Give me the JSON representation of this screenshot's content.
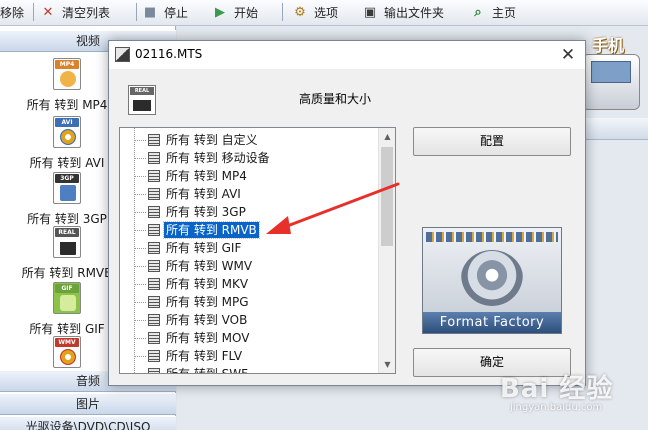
{
  "toolbar": {
    "items": [
      {
        "label": "移除",
        "icon": "remove-icon"
      },
      {
        "label": "清空列表",
        "icon": "clear-list-icon"
      },
      {
        "label": "停止",
        "icon": "stop-icon"
      },
      {
        "label": "开始",
        "icon": "start-icon"
      },
      {
        "label": "选项",
        "icon": "options-icon"
      },
      {
        "label": "输出文件夹",
        "icon": "output-folder-icon"
      },
      {
        "label": "主页",
        "icon": "home-icon"
      }
    ]
  },
  "sidebar": {
    "video_header": "视频",
    "items": [
      {
        "label": "所有 转到 MP4",
        "tag": "MP4",
        "icon": "mp4-format-icon",
        "color": "#d9822b"
      },
      {
        "label": "所有 转到 AVI",
        "tag": "AVI",
        "icon": "avi-format-icon",
        "color": "#3a6fb5"
      },
      {
        "label": "所有 转到 3GP",
        "tag": "3GP",
        "icon": "3gp-format-icon",
        "color": "#333333"
      },
      {
        "label": "所有 转到 RMVB",
        "tag": "REAL",
        "icon": "rmvb-format-icon",
        "color": "#555555"
      },
      {
        "label": "所有 转到 GIF",
        "tag": "GIF",
        "icon": "gif-format-icon",
        "color": "#6aa33a"
      },
      {
        "label": "",
        "tag": "WMV",
        "icon": "wmv-format-icon",
        "color": "#c0392b"
      }
    ],
    "audio_header": "音频",
    "image_header": "图片",
    "rom_header": "光驱设备\\DVD\\CD\\ISO"
  },
  "background": {
    "device_label": "手机"
  },
  "dialog": {
    "title": "02116.MTS",
    "close_icon": "close-icon",
    "quality_label": "高质量和大小",
    "tree_items": [
      "所有 转到 自定义",
      "所有 转到 移动设备",
      "所有 转到 MP4",
      "所有 转到 AVI",
      "所有 转到 3GP",
      "所有 转到 RMVB",
      "所有 转到 GIF",
      "所有 转到 WMV",
      "所有 转到 MKV",
      "所有 转到 MPG",
      "所有 转到 VOB",
      "所有 转到 MOV",
      "所有 转到 FLV",
      "所有 转到 SWF"
    ],
    "selected_item": "所有 转到 RMVB",
    "config_button": "配置",
    "ok_button": "确定",
    "brand_label": "Format Factory"
  },
  "watermark": {
    "logo": "Bai 经验",
    "url": "jingyan.baidu.com"
  },
  "colors": {
    "selection": "#0a64c8",
    "annotation_arrow": "#e8302a",
    "sidebar_header": "#c9d7ea"
  }
}
